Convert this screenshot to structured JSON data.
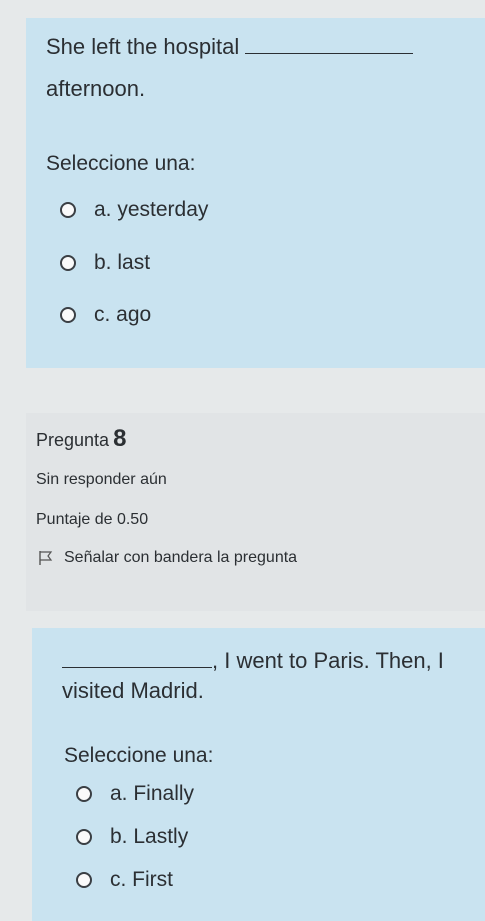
{
  "question7": {
    "text_before_blank": "She left the hospital",
    "text_after_blank": "afternoon.",
    "prompt": "Seleccione una:",
    "options": [
      "a. yesterday",
      "b. last",
      "c. ago"
    ]
  },
  "question8_info": {
    "label": "Pregunta",
    "number": "8",
    "status": "Sin responder aún",
    "score": "Puntaje de 0.50",
    "flag_label": "Señalar con bandera la pregunta"
  },
  "question8": {
    "text_after_blank": ", I went to Paris. Then, I",
    "text_line2": "visited Madrid.",
    "prompt": "Seleccione una:",
    "options": [
      "a. Finally",
      "b. Lastly",
      "c. First"
    ]
  }
}
